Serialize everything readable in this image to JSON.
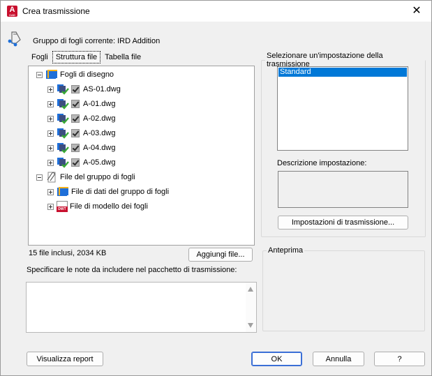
{
  "window": {
    "title": "Crea trasmissione",
    "logo_letter": "A",
    "logo_sub": "CAD",
    "close_glyph": "✕"
  },
  "sheetset": {
    "label": "Gruppo di fogli corrente: IRD Addition"
  },
  "tabs": [
    {
      "label": "Fogli",
      "active": false
    },
    {
      "label": "Struttura file",
      "active": true
    },
    {
      "label": "Tabella file",
      "active": false
    }
  ],
  "tree": {
    "root": {
      "label": "Fogli di disegno",
      "icon": "sheets-folder-icon"
    },
    "sheets": [
      {
        "label": "AS-01.dwg",
        "checked": true
      },
      {
        "label": "A-01.dwg",
        "checked": true
      },
      {
        "label": "A-02.dwg",
        "checked": true
      },
      {
        "label": "A-03.dwg",
        "checked": true
      },
      {
        "label": "A-04.dwg",
        "checked": true
      },
      {
        "label": "A-05.dwg",
        "checked": true
      }
    ],
    "sheetset_files": {
      "label": "File del gruppo di fogli",
      "icon": "paperclip-icon"
    },
    "sheetset_children": [
      {
        "label": "File di dati del gruppo di fogli",
        "icon": "sheetset-data-icon"
      },
      {
        "label": "File di modello dei fogli",
        "icon": "dwt-template-icon",
        "badge": "DWT"
      }
    ]
  },
  "stats": {
    "text": "15 file inclusi, 2034 KB"
  },
  "buttons": {
    "add_file": "Aggiungi file...",
    "view_report": "Visualizza report",
    "ok": "OK",
    "cancel": "Annulla",
    "help": "?",
    "transmittal_setups": "Impostazioni di trasmissione..."
  },
  "notes": {
    "label": "Specificare le note da includere nel pacchetto di trasmissione:",
    "value": ""
  },
  "setup": {
    "group_label": "Selezionare un'impostazione della trasmissione",
    "options": [
      "Standard"
    ],
    "selected": "Standard",
    "description_label": "Descrizione impostazione:",
    "description_value": ""
  },
  "preview": {
    "group_label": "Anteprima"
  },
  "colors": {
    "selection": "#0078d7",
    "default_button_border": "#3b6fd6",
    "logo_red": "#c8102e",
    "check_green": "#3aa935"
  }
}
